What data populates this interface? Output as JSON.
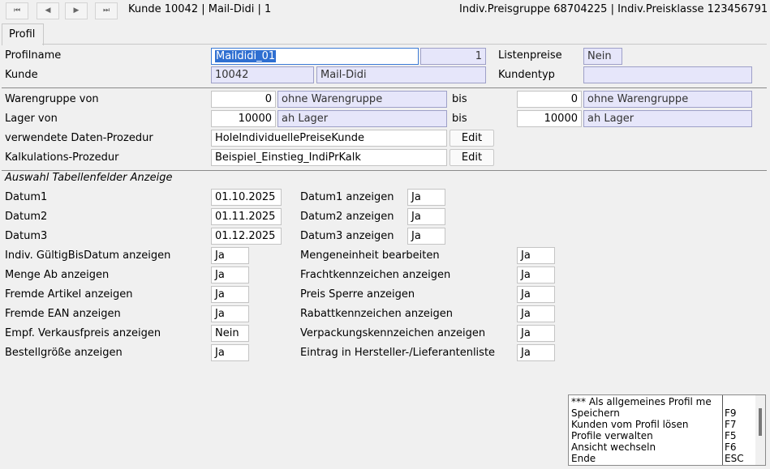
{
  "titlebar": {
    "left": "Kunde 10042 | Mail-Didi | 1",
    "right": "Indiv.Preisgruppe 68704225 |  Indiv.Preisklasse 123456791",
    "nav_icons": [
      "first-icon",
      "prev-icon",
      "next-icon",
      "last-icon"
    ]
  },
  "tab": {
    "label": "Profil"
  },
  "profil": {
    "profilname_label": "Profilname",
    "profilname_value": "Maildidi_01",
    "profil_nr": "1",
    "listenpreise_label": "Listenpreise",
    "listenpreise_value": "Nein",
    "kunde_label": "Kunde",
    "kunde_nr": "10042",
    "kunde_name": "Mail-Didi",
    "kundentyp_label": "Kundentyp",
    "kundentyp_value": ""
  },
  "filter": {
    "warengruppe_label": "Warengruppe von",
    "wg_von_nr": "0",
    "wg_von_name": "ohne Warengruppe",
    "bis_label": "bis",
    "wg_bis_nr": "0",
    "wg_bis_name": "ohne Warengruppe",
    "lager_label": "Lager von",
    "lager_von_nr": "10000",
    "lager_von_name": "ah Lager",
    "lager_bis_nr": "10000",
    "lager_bis_name": "ah Lager",
    "daten_label": "verwendete Daten-Prozedur",
    "daten_value": "HoleIndividuellePreiseKunde",
    "kalk_label": "Kalkulations-Prozedur",
    "kalk_value": "Beispiel_Einstieg_IndiPrKalk",
    "edit_label": "Edit"
  },
  "anzeige": {
    "section_title": "Auswahl Tabellenfelder Anzeige",
    "datum1_label": "Datum1",
    "datum1_value": "01.10.2025",
    "datum1_show_label": "Datum1 anzeigen",
    "datum1_show_value": "Ja",
    "datum2_label": "Datum2",
    "datum2_value": "01.11.2025",
    "datum2_show_label": "Datum2 anzeigen",
    "datum2_show_value": "Ja",
    "datum3_label": "Datum3",
    "datum3_value": "01.12.2025",
    "datum3_show_label": "Datum3 anzeigen",
    "datum3_show_value": "Ja",
    "left_rows": [
      {
        "label": "Indiv. GültigBisDatum anzeigen",
        "value": "Ja"
      },
      {
        "label": "Menge Ab anzeigen",
        "value": "Ja"
      },
      {
        "label": "Fremde Artikel anzeigen",
        "value": "Ja"
      },
      {
        "label": "Fremde EAN anzeigen",
        "value": "Ja"
      },
      {
        "label": "Empf. Verkausfpreis anzeigen",
        "value": "Nein"
      },
      {
        "label": "Bestellgröße anzeigen",
        "value": "Ja"
      }
    ],
    "right_rows": [
      {
        "label": "Mengeneinheit bearbeiten",
        "value": "Ja"
      },
      {
        "label": "Frachtkennzeichen anzeigen",
        "value": "Ja"
      },
      {
        "label": "Preis Sperre anzeigen",
        "value": "Ja"
      },
      {
        "label": "Rabattkennzeichen anzeigen",
        "value": "Ja"
      },
      {
        "label": "Verpackungskennzeichen anzeigen",
        "value": "Ja"
      },
      {
        "label": "Eintrag in Hersteller-/Lieferantenliste",
        "value": "Ja"
      }
    ]
  },
  "menu": {
    "items": [
      {
        "label": "*** Als allgemeines Profil me",
        "key": ""
      },
      {
        "label": "Speichern",
        "key": "F9"
      },
      {
        "label": "Kunden vom Profil lösen",
        "key": "F7"
      },
      {
        "label": "Profile verwalten",
        "key": "F5"
      },
      {
        "label": "Ansicht wechseln",
        "key": "F6"
      },
      {
        "label": "Ende",
        "key": "ESC"
      }
    ]
  }
}
